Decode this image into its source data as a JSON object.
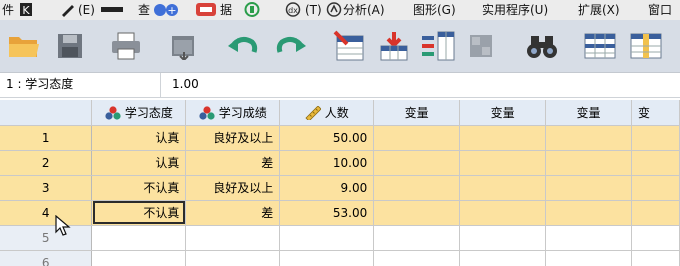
{
  "menubar": {
    "items": [
      {
        "label": "件"
      },
      {
        "label": "(E)"
      },
      {
        "label": "查"
      },
      {
        "label": "据"
      },
      {
        "label": "(T)"
      },
      {
        "label": "分析(A)"
      },
      {
        "label": "图形(G)"
      },
      {
        "label": "实用程序(U)"
      },
      {
        "label": "扩展(X)"
      },
      {
        "label": "窗口"
      }
    ]
  },
  "toolbar": {
    "buttons": [
      {
        "name": "open-file-icon"
      },
      {
        "name": "save-icon"
      },
      {
        "name": "print-icon"
      },
      {
        "name": "dialog-recall-icon"
      },
      {
        "name": "undo-icon"
      },
      {
        "name": "redo-icon"
      },
      {
        "name": "goto-case-icon"
      },
      {
        "name": "goto-variable-icon"
      },
      {
        "name": "variables-icon"
      },
      {
        "name": "run-descriptives-icon"
      },
      {
        "name": "find-icon"
      },
      {
        "name": "insert-cases-icon"
      },
      {
        "name": "insert-variable-icon"
      }
    ]
  },
  "editbar": {
    "cell_ref": "1 : 学习态度",
    "cell_value": "1.00"
  },
  "grid": {
    "columns": [
      {
        "label": "学习态度",
        "type": "nominal"
      },
      {
        "label": "学习成绩",
        "type": "nominal"
      },
      {
        "label": "人数",
        "type": "scale"
      },
      {
        "label": "变量",
        "type": "none"
      },
      {
        "label": "变量",
        "type": "none"
      },
      {
        "label": "变量",
        "type": "none"
      },
      {
        "label": "变",
        "type": "none"
      }
    ],
    "rows": [
      {
        "num": "1",
        "values": [
          "认真",
          "良好及以上",
          "50.00"
        ]
      },
      {
        "num": "2",
        "values": [
          "认真",
          "差",
          "10.00"
        ]
      },
      {
        "num": "3",
        "values": [
          "不认真",
          "良好及以上",
          "9.00"
        ]
      },
      {
        "num": "4",
        "values": [
          "不认真",
          "差",
          "53.00"
        ]
      },
      {
        "num": "5",
        "values": [
          "",
          "",
          ""
        ]
      },
      {
        "num": "6",
        "values": [
          "",
          "",
          ""
        ]
      }
    ]
  },
  "colors": {
    "menubar_bg": "#ececec",
    "toolbar_bg": "#d7dde6",
    "header_bg": "#e3ebf5",
    "data_cell_bg": "#fce2a0",
    "row_header_bg": "#fbe3a0"
  }
}
